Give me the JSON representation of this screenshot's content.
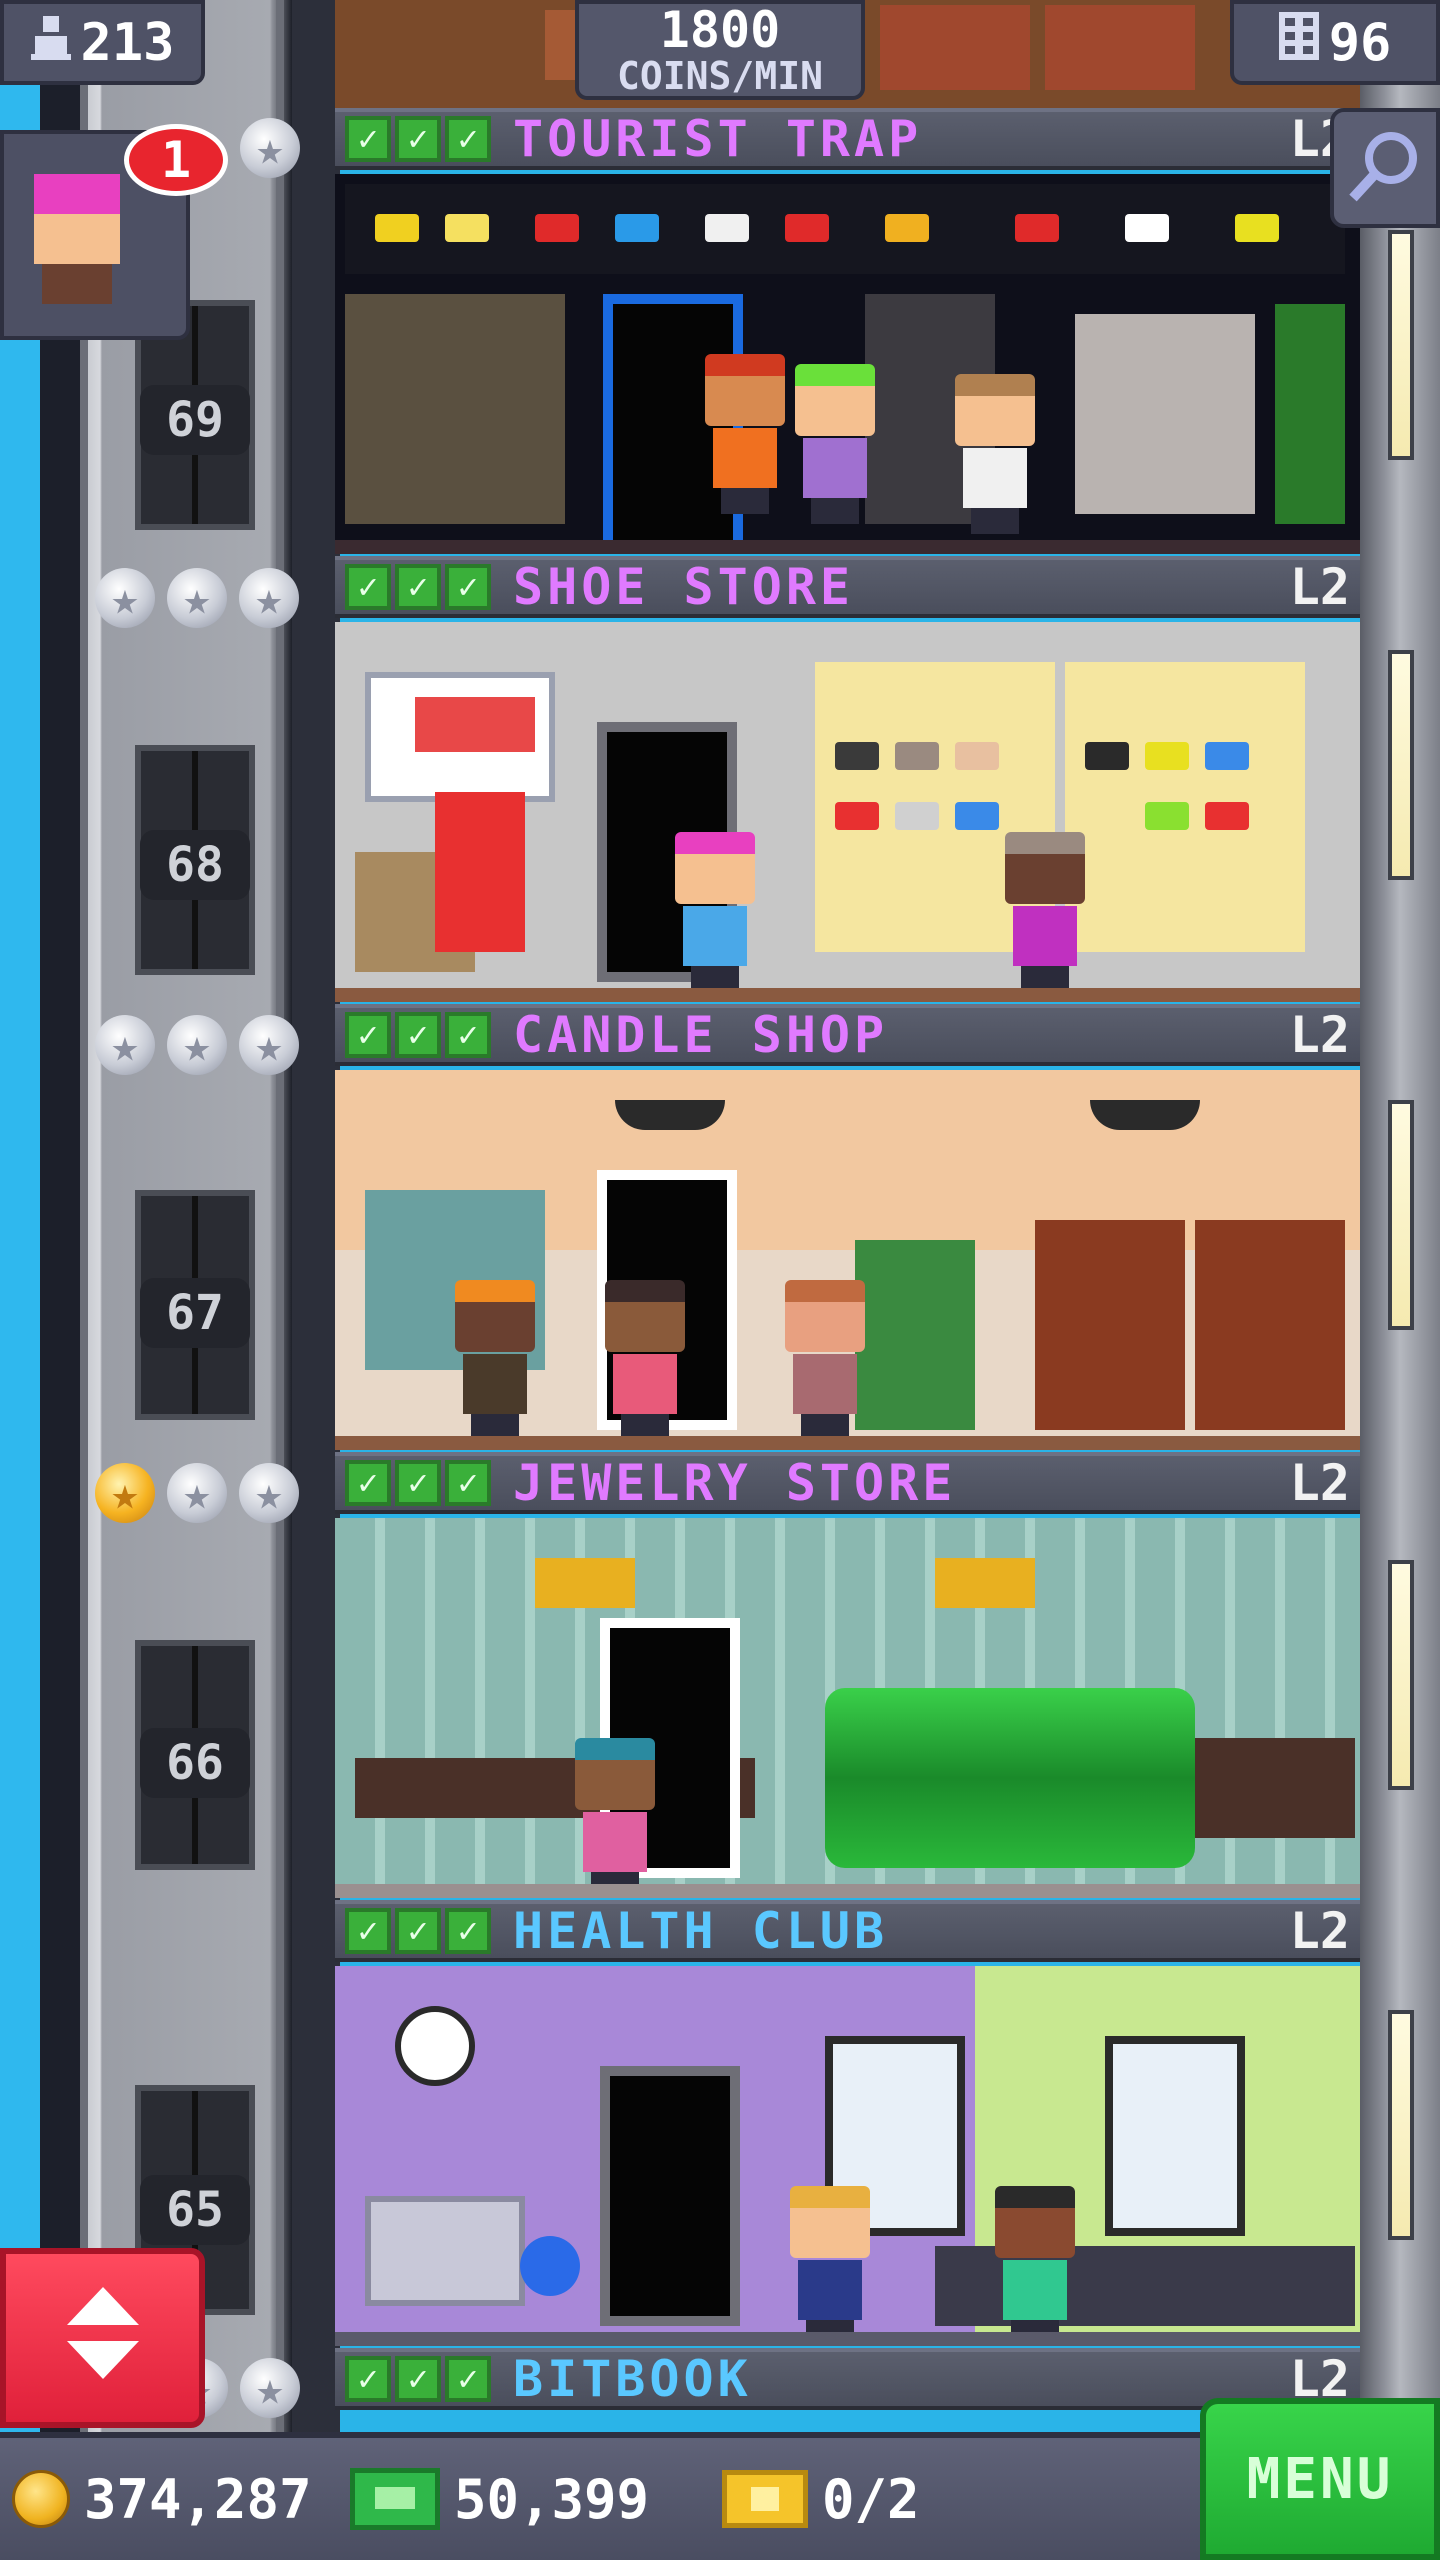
{
  "hud": {
    "population": "213",
    "coins_per_min_value": "1800",
    "coins_per_min_unit": "COINS/MIN",
    "floors_count": "96",
    "notification_count": "1"
  },
  "floors": [
    {
      "name": "TOURIST TRAP",
      "level": "L2",
      "color": "#e07aff",
      "number": "69",
      "stars": [
        "silver"
      ]
    },
    {
      "name": "SHOE STORE",
      "level": "L2",
      "color": "#e07aff",
      "number": "68",
      "stars": [
        "silver",
        "silver",
        "silver"
      ]
    },
    {
      "name": "CANDLE SHOP",
      "level": "L2",
      "color": "#e07aff",
      "number": "67",
      "stars": [
        "silver",
        "silver",
        "silver"
      ]
    },
    {
      "name": "JEWELRY STORE",
      "level": "L2",
      "color": "#e07aff",
      "number": "66",
      "stars": [
        "gold",
        "silver",
        "silver"
      ]
    },
    {
      "name": "HEALTH CLUB",
      "level": "L2",
      "color": "#5ac8ff",
      "number": "65",
      "stars": []
    },
    {
      "name": "BITBOOK",
      "level": "L2",
      "color": "#5ac8ff",
      "stars": [
        "silver",
        "silver"
      ]
    }
  ],
  "bottom": {
    "coins": "374,287",
    "bux": "50,399",
    "tickets": "0/2",
    "menu_label": "MENU"
  },
  "icons": {
    "population": "person-icon",
    "floors": "building-icon",
    "search": "magnifier-icon",
    "updown": "up-down-arrows-icon",
    "coin": "coin-icon",
    "bux": "bux-icon",
    "ticket": "golden-ticket-icon"
  },
  "colors": {
    "retail_label": "#e07aff",
    "service_label": "#5ac8ff",
    "menu_button": "#2ac43e",
    "elevator_button": "#ff3048",
    "badge": "#e8252e"
  }
}
